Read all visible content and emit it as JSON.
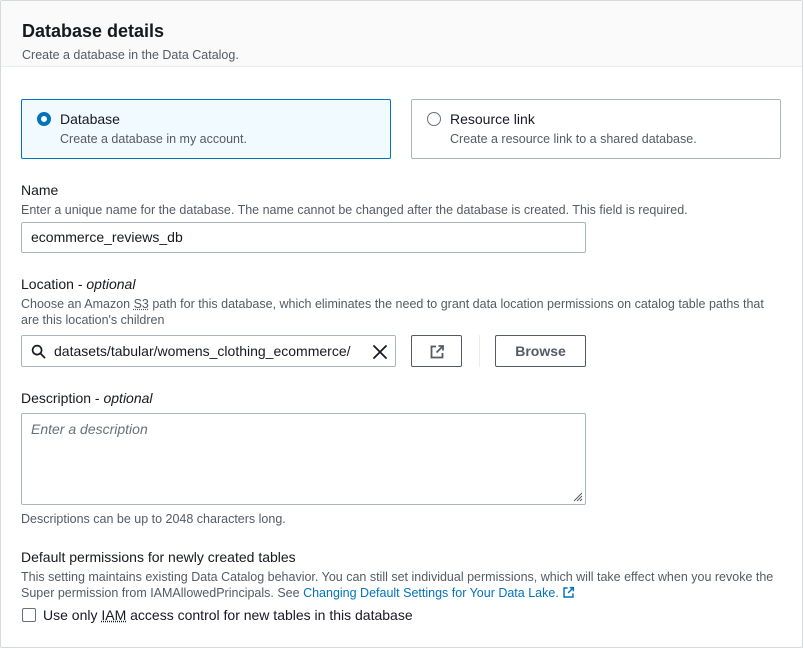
{
  "header": {
    "title": "Database details",
    "subtitle": "Create a database in the Data Catalog."
  },
  "type_options": [
    {
      "label": "Database",
      "description": "Create a database in my account.",
      "selected": true
    },
    {
      "label": "Resource link",
      "description": "Create a resource link to a shared database.",
      "selected": false
    }
  ],
  "name_field": {
    "label": "Name",
    "hint": "Enter a unique name for the database. The name cannot be changed after the database is created. This field is required.",
    "value": "ecommerce_reviews_db"
  },
  "location_field": {
    "label": "Location",
    "optional": "optional",
    "hint_before": "Choose an Amazon ",
    "hint_s3": "S3",
    "hint_after": " path for this database, which eliminates the need to grant data location permissions on catalog table paths that are this location's children",
    "value": "datasets/tabular/womens_clothing_ecommerce/",
    "browse_label": "Browse"
  },
  "description_field": {
    "label": "Description",
    "optional": "optional",
    "placeholder": "Enter a description",
    "hint": "Descriptions can be up to 2048 characters long."
  },
  "permissions": {
    "title": "Default permissions for newly created tables",
    "hint": "This setting maintains existing Data Catalog behavior. You can still set individual permissions, which will take effect when you revoke the Super permission from IAMAllowedPrincipals. See ",
    "link_text": "Changing Default Settings for Your Data Lake.",
    "checkbox_before": "Use only ",
    "checkbox_iam": "IAM",
    "checkbox_after": " access control for new tables in this database",
    "checked": false
  },
  "colors": {
    "accent": "#0073bb",
    "text": "#16191f",
    "secondary_text": "#545b64",
    "border": "#aab7b8"
  }
}
